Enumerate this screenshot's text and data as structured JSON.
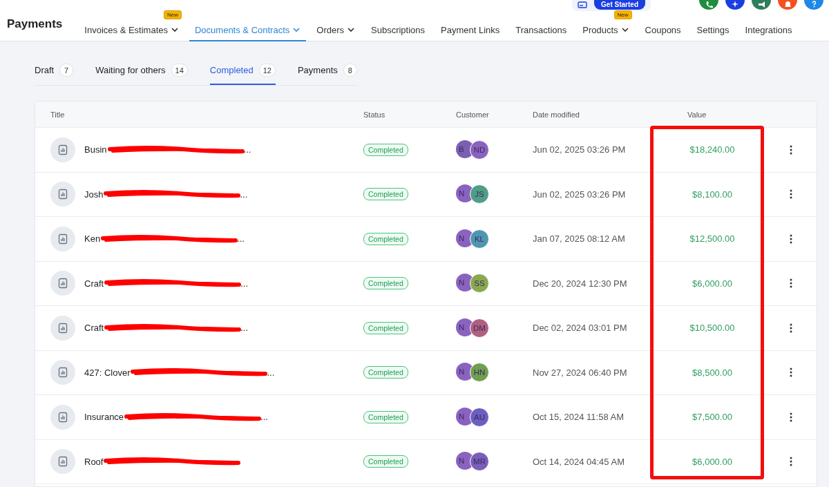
{
  "header": {
    "title": "Payments",
    "get_started": "Get Started",
    "nav": [
      {
        "label": "Invoices & Estimates",
        "badge": "New",
        "dropdown": true,
        "selected": false
      },
      {
        "label": "Documents & Contracts",
        "dropdown": true,
        "selected": true
      },
      {
        "label": "Orders",
        "dropdown": true,
        "selected": false
      },
      {
        "label": "Subscriptions",
        "dropdown": false,
        "selected": false
      },
      {
        "label": "Payment Links",
        "dropdown": false,
        "selected": false
      },
      {
        "label": "Transactions",
        "dropdown": false,
        "selected": false
      },
      {
        "label": "Products",
        "badge": "New",
        "dropdown": true,
        "selected": false
      },
      {
        "label": "Coupons",
        "dropdown": false,
        "selected": false
      },
      {
        "label": "Settings",
        "dropdown": false,
        "selected": false
      },
      {
        "label": "Integrations",
        "dropdown": false,
        "selected": false
      }
    ],
    "actions": [
      {
        "kind": "phone",
        "color": "#1e8e3e"
      },
      {
        "kind": "sparkle",
        "color": "#1a3ee0"
      },
      {
        "kind": "megaphone",
        "color": "#2e7d5b"
      },
      {
        "kind": "bell",
        "color": "#f4511e"
      },
      {
        "kind": "help",
        "color": "#1e88e5"
      }
    ]
  },
  "tabs": [
    {
      "label": "Draft",
      "count": "7",
      "selected": false
    },
    {
      "label": "Waiting for others",
      "count": "14",
      "selected": false
    },
    {
      "label": "Completed",
      "count": "12",
      "selected": true
    },
    {
      "label": "Payments",
      "count": "8",
      "selected": false
    }
  ],
  "table": {
    "columns": [
      "Title",
      "Status",
      "Customer",
      "Date modified",
      "Value"
    ],
    "rows": [
      {
        "title": "Busin",
        "redacted": true,
        "tail": "...",
        "status": "Completed",
        "customers": [
          {
            "initials": "B",
            "color": "#7b5fb0"
          },
          {
            "initials": "ND",
            "color": "#8a63bf"
          }
        ],
        "date": "Jun 02, 2025 03:26 PM",
        "value": "$18,240.00"
      },
      {
        "title": "Josh",
        "redacted": true,
        "tail": "...",
        "status": "Completed",
        "customers": [
          {
            "initials": "N",
            "color": "#8a63bf"
          },
          {
            "initials": "JS",
            "color": "#4f9e87"
          }
        ],
        "date": "Jun 02, 2025 03:26 PM",
        "value": "$8,100.00"
      },
      {
        "title": "Ken",
        "redacted": true,
        "tail": "...",
        "status": "Completed",
        "customers": [
          {
            "initials": "N",
            "color": "#8a63bf"
          },
          {
            "initials": "KL",
            "color": "#4f97b0"
          }
        ],
        "date": "Jan 07, 2025 08:12 AM",
        "value": "$12,500.00"
      },
      {
        "title": "Craft",
        "redacted": true,
        "tail": "...",
        "status": "Completed",
        "customers": [
          {
            "initials": "N",
            "color": "#8a63bf"
          },
          {
            "initials": "SS",
            "color": "#8aa84f"
          }
        ],
        "date": "Dec 20, 2024 12:30 PM",
        "value": "$6,000.00"
      },
      {
        "title": "Craft",
        "redacted": true,
        "tail": "...",
        "status": "Completed",
        "customers": [
          {
            "initials": "N",
            "color": "#8a63bf"
          },
          {
            "initials": "DM",
            "color": "#b0607e"
          }
        ],
        "date": "Dec 02, 2024 03:01 PM",
        "value": "$10,500.00"
      },
      {
        "title": "427: Clover",
        "redacted": true,
        "tail": "...",
        "status": "Completed",
        "customers": [
          {
            "initials": "N",
            "color": "#8a63bf"
          },
          {
            "initials": "HN",
            "color": "#6f9f4f"
          }
        ],
        "date": "Nov 27, 2024 06:40 PM",
        "value": "$8,500.00"
      },
      {
        "title": "Insurance",
        "redacted": true,
        "tail": "...",
        "status": "Completed",
        "customers": [
          {
            "initials": "N",
            "color": "#8a63bf"
          },
          {
            "initials": "AU",
            "color": "#6b5fc0"
          }
        ],
        "date": "Oct 15, 2024 11:58 AM",
        "value": "$7,500.00"
      },
      {
        "title": "Roof",
        "redacted": true,
        "status": "Completed",
        "customers": [
          {
            "initials": "N",
            "color": "#8a63bf"
          },
          {
            "initials": "MR",
            "color": "#7a5fb8"
          }
        ],
        "date": "Oct 14, 2024 04:45 AM",
        "value": "$6,000.00"
      }
    ]
  },
  "highlight": {
    "on": true
  }
}
